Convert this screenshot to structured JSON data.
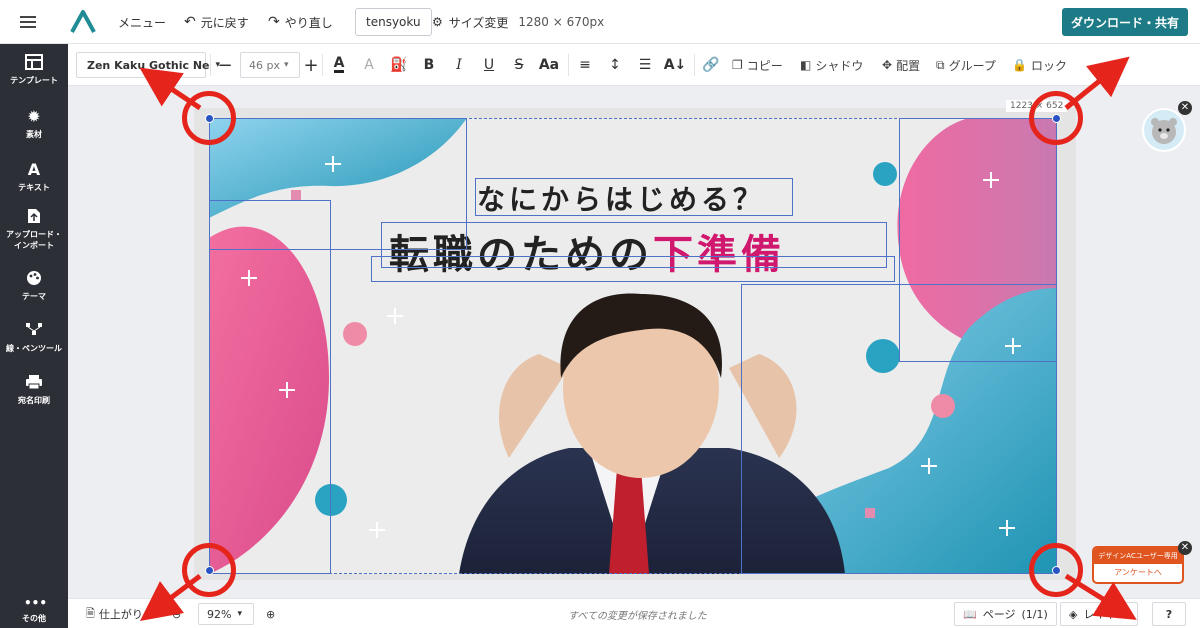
{
  "header": {
    "menu_label": "メニュー",
    "undo_label": "元に戻す",
    "redo_label": "やり直し",
    "file_name": "tensyoku",
    "resize_label": "サイズ変更",
    "resize_dims": "1280 × 670px",
    "download_label": "ダウンロード・共有"
  },
  "sidebar": {
    "items": [
      {
        "label": "テンプレート",
        "icon": "template-icon"
      },
      {
        "label": "素材",
        "icon": "gear-icon"
      },
      {
        "label": "テキスト",
        "icon": "text-icon"
      },
      {
        "label": "アップロード・",
        "label2": "インポート",
        "icon": "upload-icon"
      },
      {
        "label": "テーマ",
        "icon": "palette-icon"
      },
      {
        "label": "線・ペンツール",
        "icon": "pen-icon"
      },
      {
        "label": "宛名印刷",
        "icon": "printer-icon"
      },
      {
        "label": "その他",
        "icon": "more-icon"
      }
    ]
  },
  "toolbar": {
    "font_family": "Zen Kaku Gothic Ne",
    "font_size": "46 px",
    "bold": "B",
    "italic": "I",
    "underline": "U",
    "strike": "S",
    "case": "Aa",
    "copy": "コピー",
    "shadow": "シャドウ",
    "arrange": "配置",
    "group": "グループ",
    "lock": "ロック"
  },
  "canvas": {
    "headline_1": "なにからはじめる？",
    "headline_2_main": "転職のための",
    "headline_2_accent": "下準備",
    "selection_dims": "1223 × 652"
  },
  "bottom": {
    "finish_label": "仕上がり",
    "zoom_level": "92%",
    "status_text": "すべての変更が保存されました",
    "page_label": "ページ",
    "page_count": "(1/1)",
    "layer_label": "レイヤー",
    "help_label": "?"
  },
  "survey": {
    "top_text": "デザインACユーザー専用",
    "bottom_text": "アンケートへ"
  },
  "colors": {
    "accent_teal": "#1c7b86",
    "sidebar_bg": "#2c2f36",
    "headline_accent": "#d0186f",
    "annotation_red": "#e5251c"
  }
}
